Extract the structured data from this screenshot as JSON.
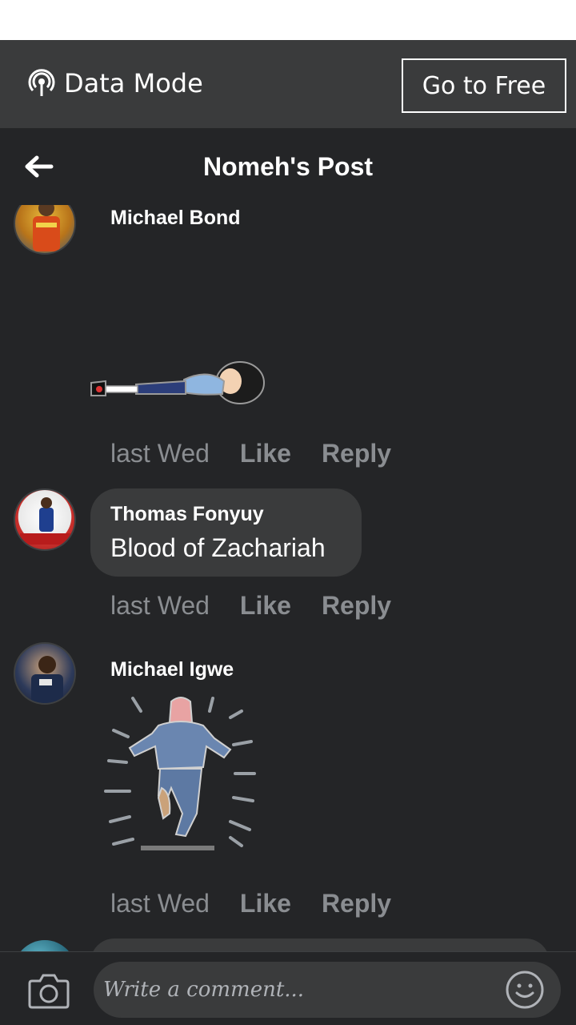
{
  "banner": {
    "mode_label": "Data Mode",
    "mode_icon": "broadcast-icon",
    "free_button": "Go to Free"
  },
  "header": {
    "title": "Nomeh's Post",
    "back_icon": "back-arrow-icon"
  },
  "comments": [
    {
      "author": "Michael Bond",
      "text": "",
      "sticker": "lying-down-sticker",
      "time": "last Wed",
      "like": "Like",
      "reply": "Reply"
    },
    {
      "author": "Thomas Fonyuy",
      "text": "Blood of Zachariah",
      "sticker": "",
      "time": "last Wed",
      "like": "Like",
      "reply": "Reply"
    },
    {
      "author": "Michael Igwe",
      "text": "",
      "sticker": "running-away-sticker",
      "time": "last Wed",
      "like": "Like",
      "reply": "Reply"
    }
  ],
  "composer": {
    "placeholder": "Write a comment...",
    "camera_icon": "camera-icon",
    "emoji_icon": "smiley-icon"
  },
  "colors": {
    "background": "#242527",
    "bar": "#3a3b3c",
    "bubble": "#3a3b3c",
    "muted_text": "#8a8d91"
  }
}
